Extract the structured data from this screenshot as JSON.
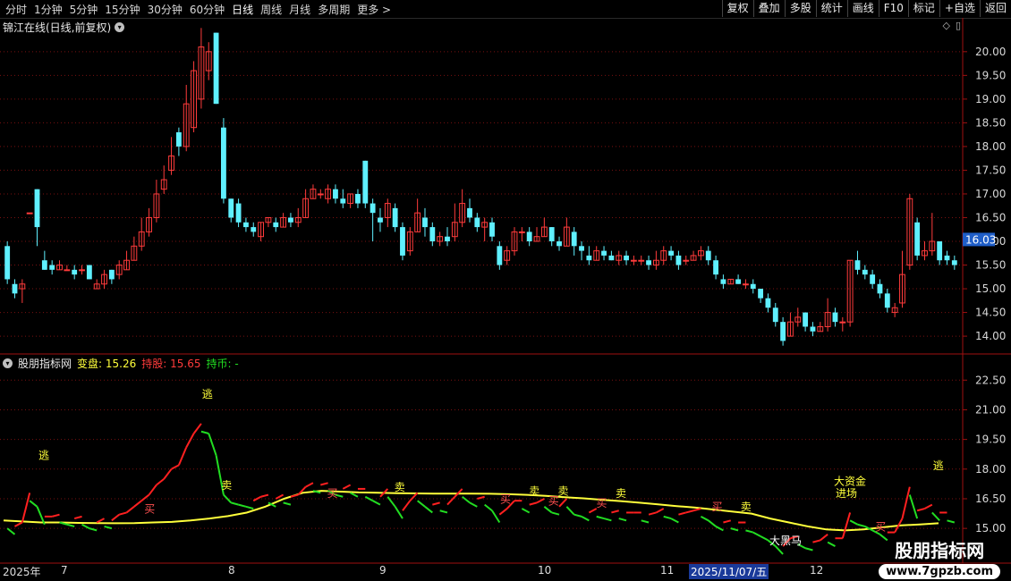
{
  "toolbar": {
    "periods": [
      "分时",
      "1分钟",
      "5分钟",
      "15分钟",
      "30分钟",
      "60分钟",
      "日线",
      "周线",
      "月线",
      "多周期",
      "更多"
    ],
    "actions": [
      "复权",
      "叠加",
      "多股",
      "统计",
      "画线",
      "F10",
      "标记",
      "+自选",
      "返回"
    ]
  },
  "main": {
    "title": "锦江在线(日线,前复权)",
    "price_ticks": [
      "20.00",
      "19.50",
      "19.00",
      "18.50",
      "18.00",
      "17.50",
      "17.00",
      "16.50",
      "16.00",
      "15.50",
      "15.00",
      "14.50",
      "14.00"
    ],
    "current_price": "16.03"
  },
  "indicator": {
    "name": "股朋指标网",
    "label1": "变盘:",
    "value1": "15.26",
    "label2": "持股:",
    "value2": "15.65",
    "label3": "持币:",
    "value3": "-",
    "ticks": [
      "22.50",
      "21.00",
      "19.50",
      "18.00",
      "16.50",
      "15.00"
    ],
    "annotations": {
      "escape": "逃",
      "sell": "卖",
      "buy": "买",
      "big_money_1": "大资金",
      "big_money_2": "进场",
      "dark_horse": "大黑马"
    }
  },
  "date_axis": {
    "year": "2025年",
    "m7": "7",
    "m8": "8",
    "m9": "9",
    "m10": "10",
    "m11": "11",
    "selected": "2025/11/07/五",
    "m12": "12"
  },
  "watermark": {
    "line1": "股朋指标网",
    "line2": "www.7gpzb.com"
  },
  "colors": {
    "up": "#ff3b3b",
    "down": "#5ff0ff",
    "ma": "#ffff3b",
    "hold": "#ff2020",
    "coin": "#22dd22",
    "grid": "#7a1010"
  },
  "chart_data": {
    "type": "candlestick",
    "price_ylim": [
      13.7,
      20.6
    ],
    "ind_ylim": [
      14.6,
      23.1
    ],
    "candles": [
      [
        15.9,
        15.2,
        16.0,
        15.1
      ],
      [
        15.1,
        14.9,
        15.2,
        14.8
      ],
      [
        15.0,
        15.1,
        15.2,
        14.7
      ],
      [
        16.6,
        16.6,
        16.6,
        16.6
      ],
      [
        17.1,
        16.3,
        17.1,
        15.9
      ],
      [
        15.6,
        15.4,
        15.8,
        15.4
      ],
      [
        15.5,
        15.4,
        15.6,
        15.3
      ],
      [
        15.4,
        15.5,
        15.6,
        15.4
      ],
      [
        15.4,
        15.4,
        15.5,
        15.4
      ],
      [
        15.4,
        15.3,
        15.5,
        15.2
      ],
      [
        15.4,
        15.4,
        15.5,
        15.3
      ],
      [
        15.5,
        15.2,
        15.5,
        15.2
      ],
      [
        15.0,
        15.1,
        15.2,
        15.0
      ],
      [
        15.1,
        15.3,
        15.4,
        15.0
      ],
      [
        15.4,
        15.2,
        15.4,
        15.1
      ],
      [
        15.3,
        15.5,
        15.6,
        15.2
      ],
      [
        15.4,
        15.6,
        15.8,
        15.4
      ],
      [
        15.6,
        15.9,
        16.1,
        15.6
      ],
      [
        15.9,
        16.2,
        16.5,
        15.8
      ],
      [
        16.2,
        16.5,
        16.7,
        16.1
      ],
      [
        16.5,
        17.0,
        17.3,
        16.4
      ],
      [
        17.1,
        17.3,
        17.6,
        17.0
      ],
      [
        17.5,
        17.8,
        18.2,
        17.4
      ],
      [
        18.3,
        18.0,
        18.4,
        17.8
      ],
      [
        18.0,
        18.9,
        19.3,
        17.9
      ],
      [
        18.4,
        19.6,
        19.8,
        18.3
      ],
      [
        19.0,
        20.1,
        20.5,
        18.8
      ],
      [
        19.6,
        20.0,
        20.2,
        19.4
      ],
      [
        20.4,
        18.9,
        20.4,
        18.9
      ],
      [
        18.4,
        16.9,
        18.6,
        16.8
      ],
      [
        16.9,
        16.5,
        16.9,
        16.4
      ],
      [
        16.8,
        16.4,
        16.9,
        16.3
      ],
      [
        16.4,
        16.3,
        16.5,
        16.2
      ],
      [
        16.3,
        16.2,
        16.4,
        16.1
      ],
      [
        16.1,
        16.4,
        16.4,
        16.0
      ],
      [
        16.4,
        16.5,
        16.5,
        16.3
      ],
      [
        16.4,
        16.3,
        16.5,
        16.2
      ],
      [
        16.3,
        16.5,
        16.6,
        16.3
      ],
      [
        16.5,
        16.4,
        16.6,
        16.3
      ],
      [
        16.4,
        16.5,
        16.7,
        16.3
      ],
      [
        16.5,
        16.9,
        17.1,
        16.5
      ],
      [
        16.9,
        17.1,
        17.2,
        16.9
      ],
      [
        17.0,
        17.0,
        17.1,
        16.9
      ],
      [
        16.9,
        17.1,
        17.2,
        16.8
      ],
      [
        17.1,
        16.9,
        17.2,
        16.8
      ],
      [
        16.9,
        16.8,
        17.1,
        16.7
      ],
      [
        16.8,
        17.0,
        17.0,
        16.7
      ],
      [
        17.0,
        16.8,
        17.1,
        16.7
      ],
      [
        17.7,
        16.8,
        17.7,
        16.7
      ],
      [
        16.8,
        16.6,
        16.9,
        16.0
      ],
      [
        16.5,
        16.4,
        16.7,
        16.2
      ],
      [
        16.5,
        16.8,
        16.9,
        16.3
      ],
      [
        16.7,
        16.3,
        16.8,
        16.2
      ],
      [
        16.3,
        15.7,
        16.4,
        15.6
      ],
      [
        15.8,
        16.2,
        16.3,
        15.7
      ],
      [
        16.2,
        16.6,
        16.9,
        16.2
      ],
      [
        16.5,
        16.3,
        16.7,
        16.1
      ],
      [
        16.3,
        16.0,
        16.4,
        15.9
      ],
      [
        16.0,
        16.1,
        16.2,
        15.9
      ],
      [
        16.1,
        16.0,
        16.3,
        15.9
      ],
      [
        16.1,
        16.4,
        16.8,
        16.0
      ],
      [
        16.4,
        16.8,
        17.1,
        16.3
      ],
      [
        16.7,
        16.5,
        16.9,
        16.4
      ],
      [
        16.5,
        16.3,
        16.6,
        16.2
      ],
      [
        16.3,
        16.4,
        16.5,
        16.0
      ],
      [
        16.4,
        16.1,
        16.5,
        16.0
      ],
      [
        15.9,
        15.5,
        16.0,
        15.4
      ],
      [
        15.6,
        15.8,
        15.9,
        15.5
      ],
      [
        15.8,
        16.2,
        16.3,
        15.7
      ],
      [
        16.2,
        16.2,
        16.3,
        16.0
      ],
      [
        16.2,
        16.0,
        16.3,
        15.9
      ],
      [
        16.0,
        16.1,
        16.3,
        16.0
      ],
      [
        16.1,
        16.3,
        16.5,
        16.1
      ],
      [
        16.3,
        16.0,
        16.3,
        15.9
      ],
      [
        16.0,
        15.9,
        16.1,
        15.8
      ],
      [
        15.9,
        16.3,
        16.5,
        15.9
      ],
      [
        16.2,
        15.9,
        16.3,
        15.7
      ],
      [
        15.9,
        15.8,
        16.0,
        15.6
      ],
      [
        15.7,
        15.6,
        15.9,
        15.5
      ],
      [
        15.6,
        15.8,
        15.9,
        15.6
      ],
      [
        15.8,
        15.7,
        15.9,
        15.6
      ],
      [
        15.7,
        15.6,
        15.8,
        15.6
      ],
      [
        15.6,
        15.7,
        15.8,
        15.5
      ],
      [
        15.7,
        15.6,
        15.8,
        15.5
      ],
      [
        15.6,
        15.6,
        15.7,
        15.5
      ],
      [
        15.6,
        15.6,
        15.7,
        15.5
      ],
      [
        15.6,
        15.5,
        15.7,
        15.4
      ],
      [
        15.5,
        15.6,
        15.8,
        15.4
      ],
      [
        15.6,
        15.8,
        15.9,
        15.5
      ],
      [
        15.8,
        15.7,
        15.9,
        15.6
      ],
      [
        15.7,
        15.5,
        15.8,
        15.4
      ],
      [
        15.6,
        15.6,
        15.7,
        15.5
      ],
      [
        15.6,
        15.7,
        15.8,
        15.6
      ],
      [
        15.7,
        15.8,
        15.9,
        15.6
      ],
      [
        15.8,
        15.6,
        15.9,
        15.5
      ],
      [
        15.6,
        15.3,
        15.7,
        15.2
      ],
      [
        15.2,
        15.1,
        15.3,
        15.0
      ],
      [
        15.1,
        15.2,
        15.2,
        15.1
      ],
      [
        15.2,
        15.1,
        15.3,
        15.1
      ],
      [
        15.1,
        15.1,
        15.2,
        15.0
      ],
      [
        15.1,
        15.0,
        15.2,
        14.9
      ],
      [
        15.0,
        14.8,
        15.0,
        14.7
      ],
      [
        14.8,
        14.6,
        14.9,
        14.5
      ],
      [
        14.6,
        14.3,
        14.7,
        14.2
      ],
      [
        14.3,
        13.9,
        14.4,
        13.8
      ],
      [
        14.0,
        14.3,
        14.5,
        14.0
      ],
      [
        14.3,
        14.4,
        14.6,
        14.2
      ],
      [
        14.5,
        14.2,
        14.5,
        14.1
      ],
      [
        14.2,
        14.1,
        14.3,
        14.0
      ],
      [
        14.1,
        14.2,
        14.3,
        14.1
      ],
      [
        14.2,
        14.5,
        14.8,
        14.1
      ],
      [
        14.5,
        14.3,
        14.6,
        14.2
      ],
      [
        14.3,
        14.3,
        14.4,
        14.1
      ],
      [
        14.3,
        15.6,
        15.6,
        14.2
      ],
      [
        15.6,
        15.4,
        15.8,
        15.3
      ],
      [
        15.4,
        15.3,
        15.5,
        15.2
      ],
      [
        15.3,
        15.1,
        15.4,
        15.0
      ],
      [
        15.1,
        14.9,
        15.2,
        14.8
      ],
      [
        14.9,
        14.6,
        15.0,
        14.5
      ],
      [
        14.5,
        14.6,
        14.7,
        14.4
      ],
      [
        14.7,
        15.3,
        15.8,
        14.6
      ],
      [
        15.5,
        16.9,
        17.0,
        15.4
      ],
      [
        16.4,
        15.7,
        16.5,
        15.6
      ],
      [
        15.7,
        15.8,
        16.0,
        15.6
      ],
      [
        15.8,
        16.0,
        16.6,
        15.7
      ],
      [
        16.0,
        15.6,
        16.0,
        15.5
      ],
      [
        15.7,
        15.6,
        15.8,
        15.5
      ],
      [
        15.6,
        15.5,
        15.7,
        15.4
      ]
    ],
    "ma_line": [
      15.4,
      15.35,
      15.3,
      15.3,
      15.28,
      15.27,
      15.26,
      15.27,
      15.3,
      15.33,
      15.4,
      15.5,
      15.62,
      15.8,
      16.1,
      16.5,
      16.8,
      16.9,
      16.86,
      16.82,
      16.8,
      16.78,
      16.77,
      16.76,
      16.76,
      16.76,
      16.75,
      16.73,
      16.7,
      16.65,
      16.58,
      16.52,
      16.45,
      16.38,
      16.3,
      16.22,
      16.13,
      16.05,
      15.95,
      15.85,
      15.75,
      15.5,
      15.3,
      15.1,
      14.95,
      14.9,
      14.95,
      15.05,
      15.15,
      15.2,
      15.26
    ],
    "events": [
      {
        "label": "逃",
        "x": 0.04,
        "y": 18.5
      },
      {
        "label": "逃",
        "x": 0.21,
        "y": 21.6
      },
      {
        "label": "卖",
        "x": 0.23,
        "y": 17.0
      },
      {
        "label": "卖",
        "x": 0.41,
        "y": 16.9
      },
      {
        "label": "卖",
        "x": 0.55,
        "y": 16.7
      },
      {
        "label": "卖",
        "x": 0.58,
        "y": 16.7
      },
      {
        "label": "卖",
        "x": 0.64,
        "y": 16.6
      },
      {
        "label": "卖",
        "x": 0.77,
        "y": 15.9
      },
      {
        "label": "买",
        "x": 0.15,
        "y": 15.8
      },
      {
        "label": "买",
        "x": 0.34,
        "y": 16.6
      },
      {
        "label": "买",
        "x": 0.52,
        "y": 16.3
      },
      {
        "label": "买",
        "x": 0.57,
        "y": 16.2
      },
      {
        "label": "买",
        "x": 0.62,
        "y": 16.1
      },
      {
        "label": "买",
        "x": 0.74,
        "y": 15.9
      },
      {
        "label": "买",
        "x": 0.91,
        "y": 14.9
      },
      {
        "label": "逃",
        "x": 0.97,
        "y": 18.0
      }
    ]
  }
}
